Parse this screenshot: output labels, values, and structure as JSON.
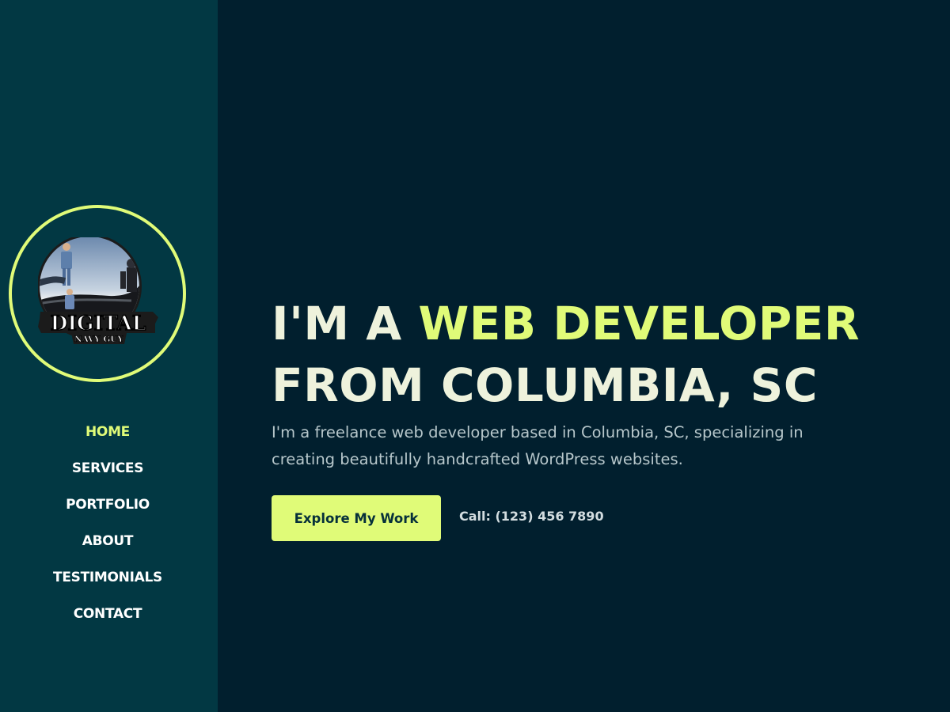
{
  "logo": {
    "icon": "digital-navy-guy-logo",
    "title": "DIGITAL",
    "subtitle": "NAVY GUY"
  },
  "nav": {
    "items": [
      {
        "label": "HOME",
        "active": true
      },
      {
        "label": "SERVICES",
        "active": false
      },
      {
        "label": "PORTFOLIO",
        "active": false
      },
      {
        "label": "ABOUT",
        "active": false
      },
      {
        "label": "TESTIMONIALS",
        "active": false
      },
      {
        "label": "CONTACT",
        "active": false
      }
    ]
  },
  "hero": {
    "headline_prefix": "I'M A ",
    "headline_accent": "WEB DEVELOPER",
    "headline_line2": "FROM COLUMBIA, SC",
    "description": "I'm a freelance web developer based in Columbia, SC, specializing in creating beautifully handcrafted WordPress websites.",
    "cta_label": "Explore My Work",
    "phone": "Call: (123) 456 7890"
  },
  "colors": {
    "sidebar_bg": "#023843",
    "main_bg": "#011f2e",
    "accent": "#e0fb78",
    "headline": "#eef2dc",
    "body_text": "#b7c7cb"
  }
}
